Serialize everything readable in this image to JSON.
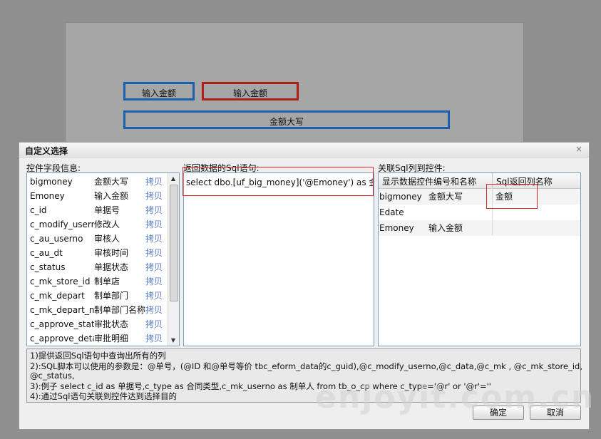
{
  "form": {
    "input_amount_1": "输入金额",
    "input_amount_2": "输入金额",
    "amount_upper": "金额大写"
  },
  "dialog": {
    "title": "自定义选择",
    "close": "×",
    "fields_label": "控件字段信息:",
    "sql_label": "返回数据的Sql语句:",
    "link_label": "关联Sql列到控件:",
    "copy_text": "拷贝",
    "fields": [
      {
        "name": "bigmoney",
        "label": "金额大写"
      },
      {
        "name": "Emoney",
        "label": "输入金额"
      },
      {
        "name": "c_id",
        "label": "单据号"
      },
      {
        "name": "c_modify_userno",
        "label": "修改人"
      },
      {
        "name": "c_au_userno",
        "label": "审核人"
      },
      {
        "name": "c_au_dt",
        "label": "审核时间"
      },
      {
        "name": "c_status",
        "label": "单据状态"
      },
      {
        "name": "c_mk_store_id",
        "label": "制单店"
      },
      {
        "name": "c_mk_depart",
        "label": "制单部门"
      },
      {
        "name": "c_mk_depart_name",
        "label": "制单部门名称"
      },
      {
        "name": "c_approve_status",
        "label": "审批状态"
      },
      {
        "name": "c_approve_detail",
        "label": "审批明细"
      }
    ],
    "sql": "select dbo.[uf_big_money]('@Emoney') as 金额",
    "grid": {
      "headers": [
        "显示数据控件编号和名称",
        "Sql返回列名称"
      ],
      "rows": [
        {
          "code": "bigmoney",
          "name": "金额大写",
          "column": "金额"
        },
        {
          "code": "Edate",
          "name": "",
          "column": ""
        },
        {
          "code": "Emoney",
          "name": "输入金额",
          "column": ""
        }
      ]
    },
    "help": [
      "1)提供返回Sql语句中查询出所有的列",
      "2):SQL脚本可以使用的参数是：@单号，(@ID 和@单号等价  tbc_eform_data的c_guid),@c_modify_userno,@c_data,@c_mk , @c_mk_store_id,",
      "      @c_status,",
      "3):例子  select c_id as 单据号,c_type as 合同类型,c_mk_userno as 制单人  from tb_o_cp where c_type='@r' or '@r'=''",
      "4):通过Sql语句关联到控件达到选择目的"
    ],
    "ok_label": "确定",
    "cancel_label": "取消"
  },
  "watermark": "enjoyit.com.cn"
}
